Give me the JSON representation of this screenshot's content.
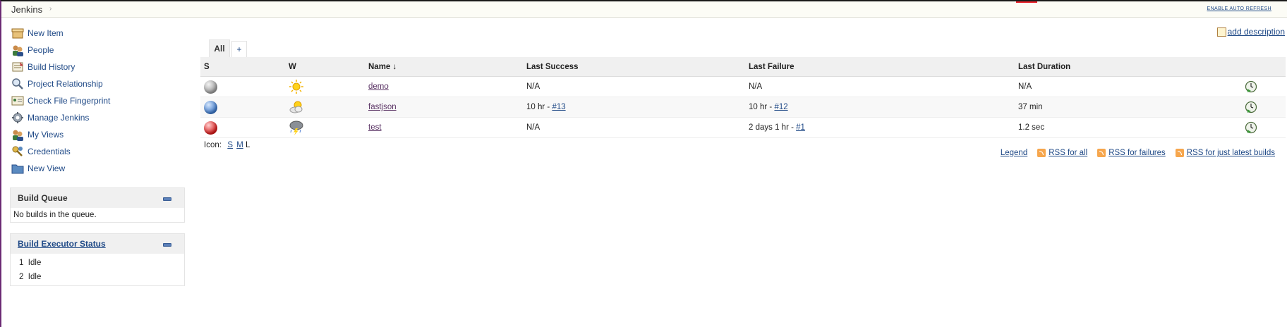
{
  "topbar": {
    "breadcrumb": "Jenkins",
    "separator": "›",
    "auto_refresh": "ENABLE AUTO REFRESH"
  },
  "sidebar": {
    "tasks": [
      {
        "label": "New Item",
        "icon": "new-item-icon"
      },
      {
        "label": "People",
        "icon": "people-icon"
      },
      {
        "label": "Build History",
        "icon": "build-history-icon"
      },
      {
        "label": "Project Relationship",
        "icon": "search-icon"
      },
      {
        "label": "Check File Fingerprint",
        "icon": "fingerprint-icon"
      },
      {
        "label": "Manage Jenkins",
        "icon": "gear-icon"
      },
      {
        "label": "My Views",
        "icon": "people-icon"
      },
      {
        "label": "Credentials",
        "icon": "key-icon"
      },
      {
        "label": "New View",
        "icon": "folder-icon"
      }
    ]
  },
  "build_queue": {
    "title": "Build Queue",
    "empty_text": "No builds in the queue."
  },
  "executors": {
    "title": "Build Executor Status",
    "items": [
      {
        "num": "1",
        "status": "Idle"
      },
      {
        "num": "2",
        "status": "Idle"
      }
    ]
  },
  "tabs": {
    "all": "All",
    "add": "+"
  },
  "add_description": "add description",
  "table": {
    "headers": {
      "s": "S",
      "w": "W",
      "name": "Name",
      "sort": "↓",
      "last_success": "Last Success",
      "last_failure": "Last Failure",
      "last_duration": "Last Duration"
    },
    "rows": [
      {
        "status": "grey",
        "weather": "sunny",
        "name": "demo",
        "success": "N/A",
        "success_link": "",
        "failure": "N/A",
        "failure_link": "",
        "duration": "N/A"
      },
      {
        "status": "blue",
        "weather": "partly-cloudy",
        "name": "fastjson",
        "success": "10 hr - ",
        "success_link": "#13",
        "failure": "10 hr - ",
        "failure_link": "#12",
        "duration": "37 min"
      },
      {
        "status": "red",
        "weather": "thunderstorm",
        "name": "test",
        "success": "N/A",
        "success_link": "",
        "failure": "2 days 1 hr - ",
        "failure_link": "#1",
        "duration": "1.2 sec"
      }
    ]
  },
  "icon_size": {
    "label": "Icon:",
    "s": "S",
    "m": "M",
    "l": "L"
  },
  "footer": {
    "legend": "Legend",
    "rss_all": "RSS for all",
    "rss_failures": "RSS for failures",
    "rss_latest": "RSS for just latest builds"
  },
  "colors": {
    "link": "#204a87",
    "visited_link": "#5c3566",
    "header_bg": "#f0f0f0",
    "rss": "#f6a64d"
  }
}
